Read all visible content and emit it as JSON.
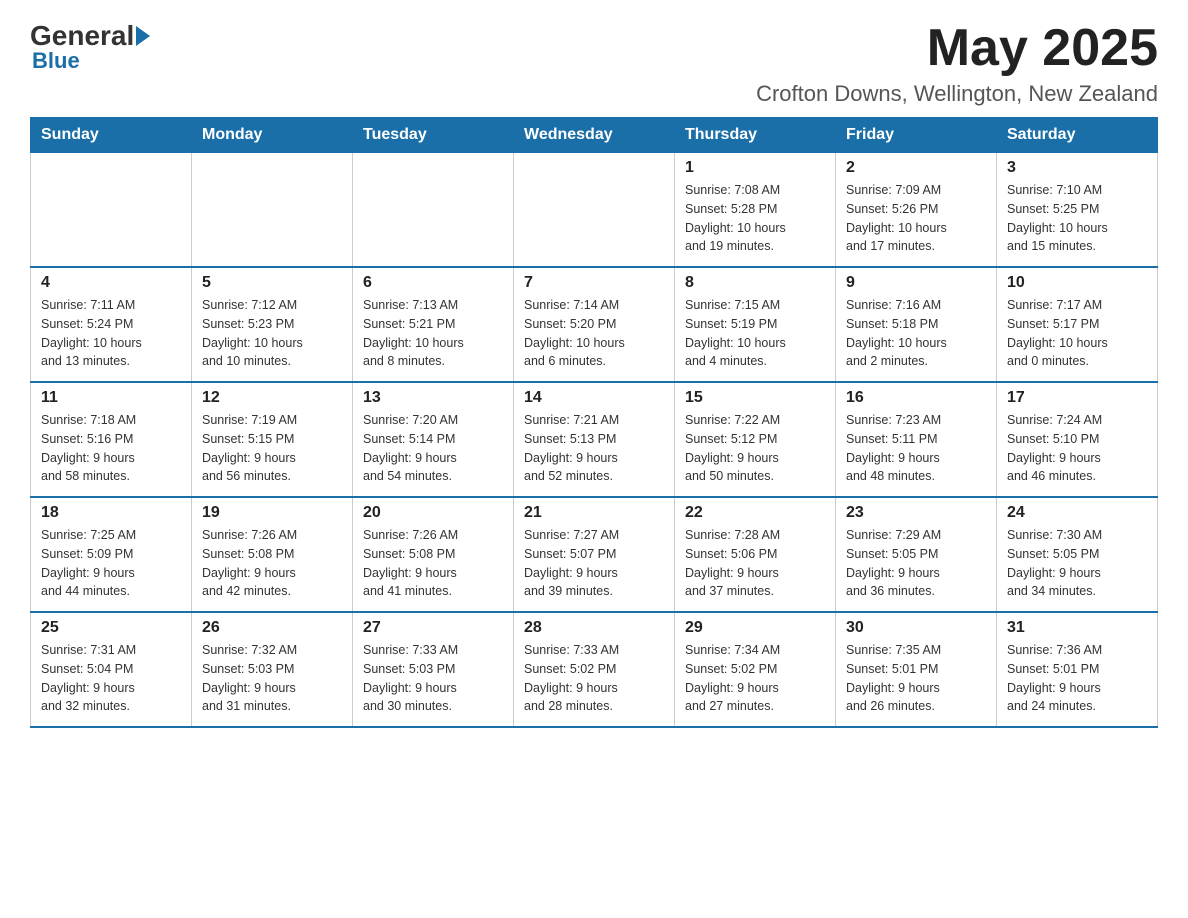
{
  "header": {
    "logo_general": "General",
    "logo_blue": "Blue",
    "month_title": "May 2025",
    "location": "Crofton Downs, Wellington, New Zealand"
  },
  "weekdays": [
    "Sunday",
    "Monday",
    "Tuesday",
    "Wednesday",
    "Thursday",
    "Friday",
    "Saturday"
  ],
  "weeks": [
    [
      {
        "day": "",
        "info": ""
      },
      {
        "day": "",
        "info": ""
      },
      {
        "day": "",
        "info": ""
      },
      {
        "day": "",
        "info": ""
      },
      {
        "day": "1",
        "info": "Sunrise: 7:08 AM\nSunset: 5:28 PM\nDaylight: 10 hours\nand 19 minutes."
      },
      {
        "day": "2",
        "info": "Sunrise: 7:09 AM\nSunset: 5:26 PM\nDaylight: 10 hours\nand 17 minutes."
      },
      {
        "day": "3",
        "info": "Sunrise: 7:10 AM\nSunset: 5:25 PM\nDaylight: 10 hours\nand 15 minutes."
      }
    ],
    [
      {
        "day": "4",
        "info": "Sunrise: 7:11 AM\nSunset: 5:24 PM\nDaylight: 10 hours\nand 13 minutes."
      },
      {
        "day": "5",
        "info": "Sunrise: 7:12 AM\nSunset: 5:23 PM\nDaylight: 10 hours\nand 10 minutes."
      },
      {
        "day": "6",
        "info": "Sunrise: 7:13 AM\nSunset: 5:21 PM\nDaylight: 10 hours\nand 8 minutes."
      },
      {
        "day": "7",
        "info": "Sunrise: 7:14 AM\nSunset: 5:20 PM\nDaylight: 10 hours\nand 6 minutes."
      },
      {
        "day": "8",
        "info": "Sunrise: 7:15 AM\nSunset: 5:19 PM\nDaylight: 10 hours\nand 4 minutes."
      },
      {
        "day": "9",
        "info": "Sunrise: 7:16 AM\nSunset: 5:18 PM\nDaylight: 10 hours\nand 2 minutes."
      },
      {
        "day": "10",
        "info": "Sunrise: 7:17 AM\nSunset: 5:17 PM\nDaylight: 10 hours\nand 0 minutes."
      }
    ],
    [
      {
        "day": "11",
        "info": "Sunrise: 7:18 AM\nSunset: 5:16 PM\nDaylight: 9 hours\nand 58 minutes."
      },
      {
        "day": "12",
        "info": "Sunrise: 7:19 AM\nSunset: 5:15 PM\nDaylight: 9 hours\nand 56 minutes."
      },
      {
        "day": "13",
        "info": "Sunrise: 7:20 AM\nSunset: 5:14 PM\nDaylight: 9 hours\nand 54 minutes."
      },
      {
        "day": "14",
        "info": "Sunrise: 7:21 AM\nSunset: 5:13 PM\nDaylight: 9 hours\nand 52 minutes."
      },
      {
        "day": "15",
        "info": "Sunrise: 7:22 AM\nSunset: 5:12 PM\nDaylight: 9 hours\nand 50 minutes."
      },
      {
        "day": "16",
        "info": "Sunrise: 7:23 AM\nSunset: 5:11 PM\nDaylight: 9 hours\nand 48 minutes."
      },
      {
        "day": "17",
        "info": "Sunrise: 7:24 AM\nSunset: 5:10 PM\nDaylight: 9 hours\nand 46 minutes."
      }
    ],
    [
      {
        "day": "18",
        "info": "Sunrise: 7:25 AM\nSunset: 5:09 PM\nDaylight: 9 hours\nand 44 minutes."
      },
      {
        "day": "19",
        "info": "Sunrise: 7:26 AM\nSunset: 5:08 PM\nDaylight: 9 hours\nand 42 minutes."
      },
      {
        "day": "20",
        "info": "Sunrise: 7:26 AM\nSunset: 5:08 PM\nDaylight: 9 hours\nand 41 minutes."
      },
      {
        "day": "21",
        "info": "Sunrise: 7:27 AM\nSunset: 5:07 PM\nDaylight: 9 hours\nand 39 minutes."
      },
      {
        "day": "22",
        "info": "Sunrise: 7:28 AM\nSunset: 5:06 PM\nDaylight: 9 hours\nand 37 minutes."
      },
      {
        "day": "23",
        "info": "Sunrise: 7:29 AM\nSunset: 5:05 PM\nDaylight: 9 hours\nand 36 minutes."
      },
      {
        "day": "24",
        "info": "Sunrise: 7:30 AM\nSunset: 5:05 PM\nDaylight: 9 hours\nand 34 minutes."
      }
    ],
    [
      {
        "day": "25",
        "info": "Sunrise: 7:31 AM\nSunset: 5:04 PM\nDaylight: 9 hours\nand 32 minutes."
      },
      {
        "day": "26",
        "info": "Sunrise: 7:32 AM\nSunset: 5:03 PM\nDaylight: 9 hours\nand 31 minutes."
      },
      {
        "day": "27",
        "info": "Sunrise: 7:33 AM\nSunset: 5:03 PM\nDaylight: 9 hours\nand 30 minutes."
      },
      {
        "day": "28",
        "info": "Sunrise: 7:33 AM\nSunset: 5:02 PM\nDaylight: 9 hours\nand 28 minutes."
      },
      {
        "day": "29",
        "info": "Sunrise: 7:34 AM\nSunset: 5:02 PM\nDaylight: 9 hours\nand 27 minutes."
      },
      {
        "day": "30",
        "info": "Sunrise: 7:35 AM\nSunset: 5:01 PM\nDaylight: 9 hours\nand 26 minutes."
      },
      {
        "day": "31",
        "info": "Sunrise: 7:36 AM\nSunset: 5:01 PM\nDaylight: 9 hours\nand 24 minutes."
      }
    ]
  ]
}
